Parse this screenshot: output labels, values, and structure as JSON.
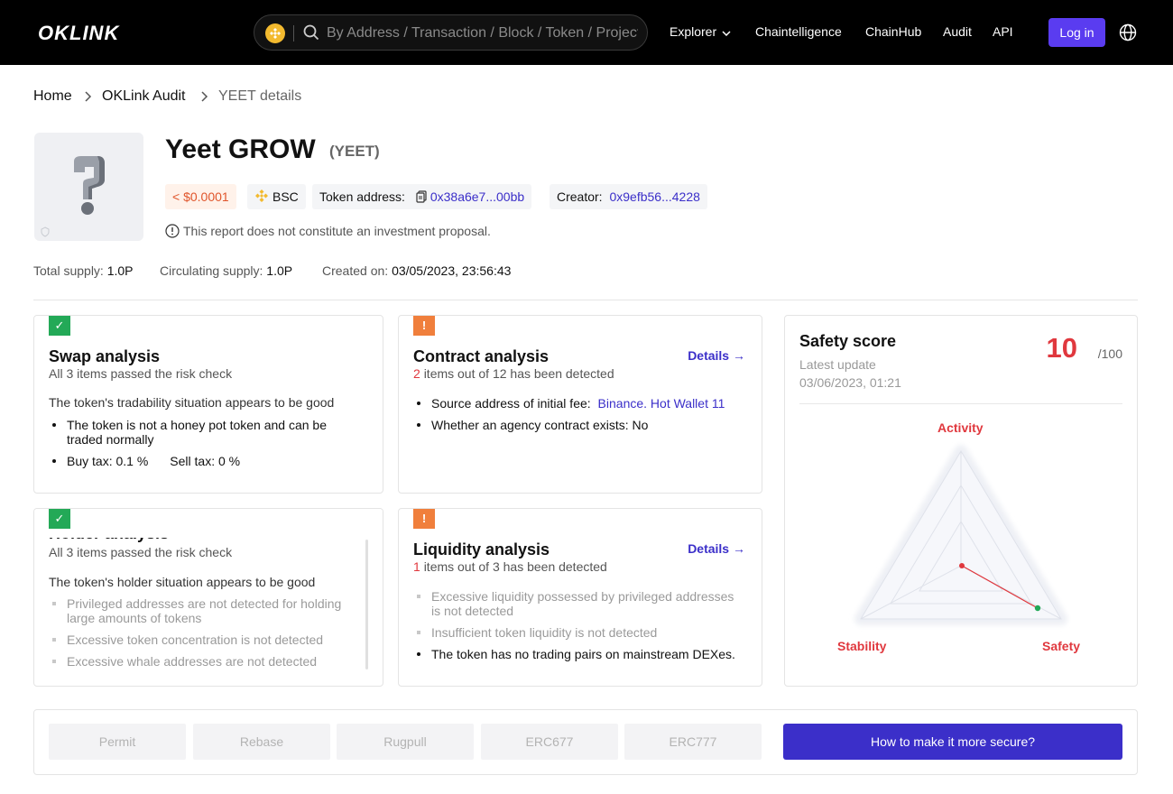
{
  "header": {
    "logo": "OKLINK",
    "search_placeholder": "By Address / Transaction / Block / Token / Project",
    "nav": [
      "Explorer",
      "Chaintelligence",
      "ChainHub",
      "Audit",
      "API"
    ],
    "login": "Log in"
  },
  "breadcrumb": [
    "Home",
    "OKLink Audit",
    "YEET details"
  ],
  "token": {
    "name": "Yeet GROW",
    "symbol": "(YEET)",
    "price": "< $0.0001",
    "chain": "BSC",
    "address_label": "Token address:",
    "address": "0x38a6e7...00bb",
    "creator_label": "Creator:",
    "creator": "0x9efb56...4228",
    "disclaimer": "This report does not constitute an investment proposal."
  },
  "stats": {
    "total_label": "Total supply:",
    "total": "1.0P",
    "circ_label": "Circulating supply:",
    "circ": "1.0P",
    "created_label": "Created on:",
    "created": "03/05/2023, 23:56:43"
  },
  "swap": {
    "title": "Swap analysis",
    "subtitle": "All 3 items passed the risk check",
    "lead": "The token's tradability situation appears to be good",
    "item1_line1": "The token is not a honey pot token and can be",
    "item1_line2": "traded normally",
    "buy_tax": "Buy tax: 0.1 %",
    "sell_tax": "Sell tax: 0 %"
  },
  "contract": {
    "title": "Contract analysis",
    "count": "2",
    "subtitle_rest": "items out of 12 has been detected",
    "details": "Details →",
    "item1_label": "Source address of initial fee:",
    "item1_link": "Binance. Hot Wallet 11",
    "item2": "Whether an agency contract exists: No"
  },
  "holder": {
    "title": "Holder analysis",
    "subtitle": "All 3 items passed the risk check",
    "lead": "The token's holder situation appears to be good",
    "item1_line1": "Privileged addresses are not detected for holding",
    "item1_line2": "large amounts of tokens",
    "item2": "Excessive token concentration is not detected",
    "item3": "Excessive whale addresses are not detected"
  },
  "liquidity": {
    "title": "Liquidity analysis",
    "count": "1",
    "subtitle_rest": "items out of 3 has been detected",
    "details": "Details →",
    "item1_line1": "Excessive liquidity possessed by privileged addresses",
    "item1_line2": "is not detected",
    "item2": "Insufficient token liquidity is not detected",
    "item3": "The token has no trading pairs on mainstream DEXes."
  },
  "safety": {
    "title": "Safety score",
    "score": "10",
    "max": "/100",
    "update_label": "Latest update",
    "update": "03/06/2023, 01:21",
    "axes": [
      "Activity",
      "Stability",
      "Safety"
    ]
  },
  "tags": [
    "Permit",
    "Rebase",
    "Rugpull",
    "ERC677",
    "ERC777"
  ],
  "secure_button": "How to make it more secure?",
  "colors": {
    "accent": "#3b2fc9",
    "danger": "#e0383e",
    "ok": "#23a957",
    "warn": "#f07f3c"
  }
}
